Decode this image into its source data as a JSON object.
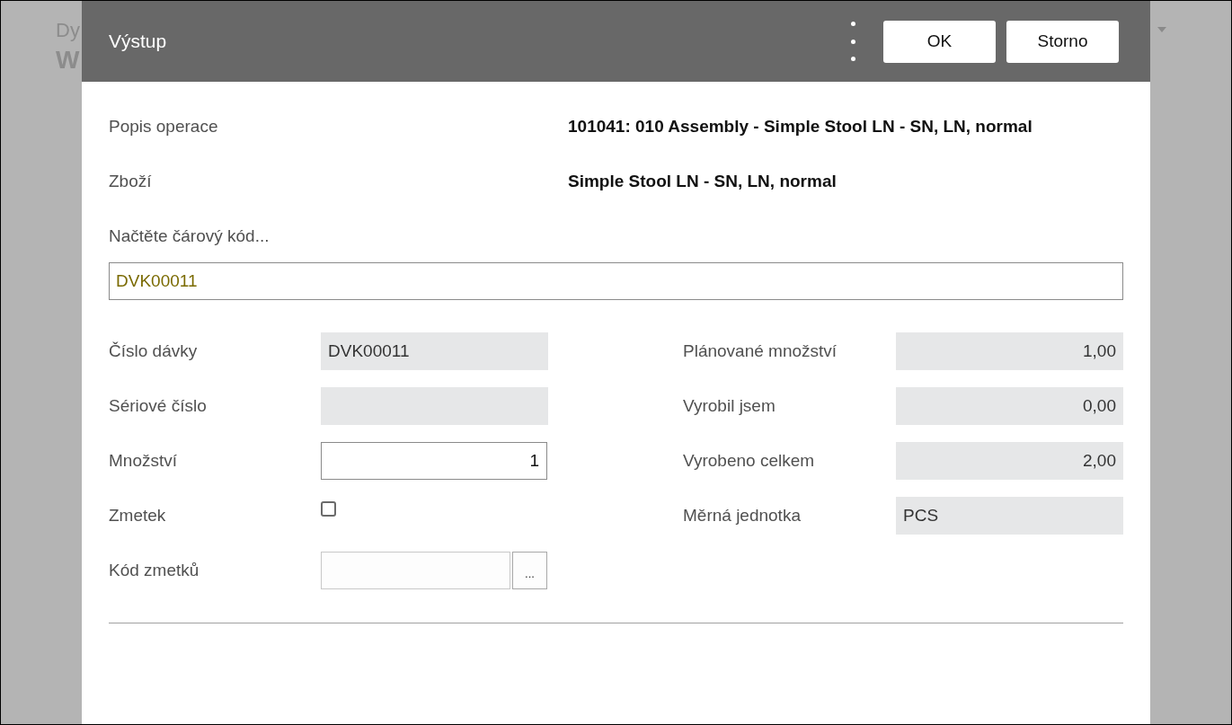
{
  "background": {
    "heading": "Dy",
    "title": "W"
  },
  "dialog": {
    "title": "Výstup",
    "buttons": [
      {
        "label": "OK"
      },
      {
        "label": "Storno"
      }
    ],
    "info": [
      {
        "label": "Popis operace",
        "value": "101041: 010 Assembly - Simple Stool LN - SN, LN, normal"
      },
      {
        "label": "Zboží",
        "value": "Simple Stool LN - SN, LN, normal"
      }
    ],
    "scan": {
      "label": "Načtěte čárový kód...",
      "value": "DVK00011"
    },
    "left_fields": [
      {
        "kind": "readonly",
        "label": "Číslo dávky",
        "value": "DVK00011"
      },
      {
        "kind": "readonly",
        "label": "Sériové číslo"
      },
      {
        "kind": "input",
        "label": "Množství",
        "value": "1"
      },
      {
        "kind": "checkbox",
        "label": "Zmetek",
        "checked": false
      },
      {
        "kind": "lookup",
        "label": "Kód zmetků",
        "button": "..."
      }
    ],
    "right_fields": [
      {
        "kind": "readonly_number",
        "label": "Plánované množství",
        "value": "1,00"
      },
      {
        "kind": "readonly_number",
        "label": "Vyrobil jsem",
        "value": "0,00"
      },
      {
        "kind": "readonly_number",
        "label": "Vyrobeno celkem",
        "value": "2,00"
      },
      {
        "kind": "readonly",
        "label": "Měrná jednotka",
        "value": "PCS"
      }
    ]
  }
}
